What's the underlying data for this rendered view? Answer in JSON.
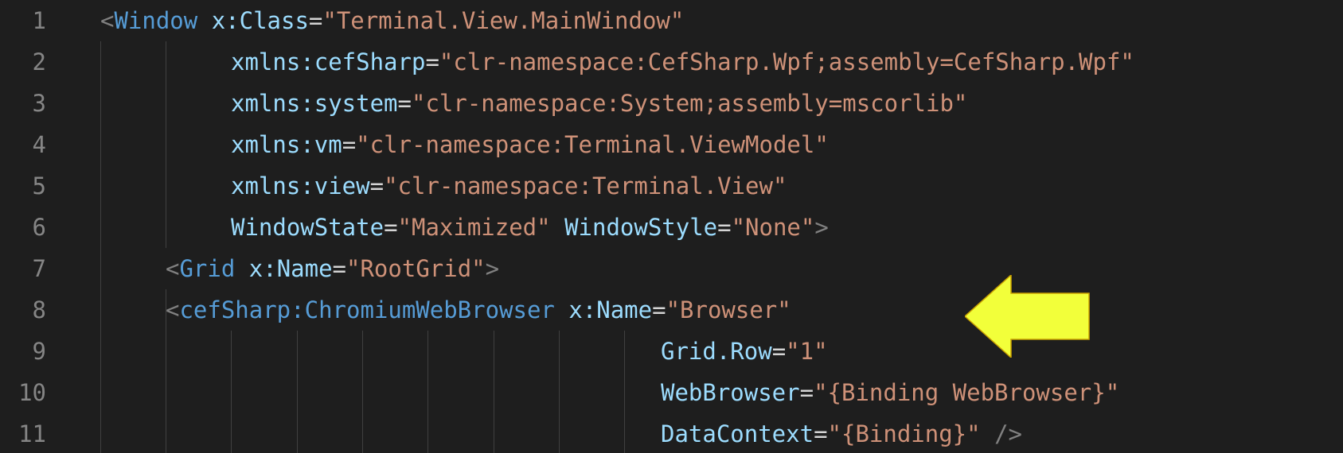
{
  "editor": {
    "accent_arrow_color": "#f2ff3a",
    "lines": [
      {
        "num": "1",
        "tokens": [
          {
            "t": "punct",
            "v": "<"
          },
          {
            "t": "tag",
            "v": "Window"
          },
          {
            "t": "eq",
            "v": " "
          },
          {
            "t": "attr",
            "v": "x:Class"
          },
          {
            "t": "eq",
            "v": "="
          },
          {
            "t": "str",
            "v": "\"Terminal.View.MainWindow\""
          }
        ]
      },
      {
        "num": "2",
        "tokens": [
          {
            "t": "attr",
            "v": "xmlns:cefSharp"
          },
          {
            "t": "eq",
            "v": "="
          },
          {
            "t": "str",
            "v": "\"clr-namespace:CefSharp.Wpf;assembly=CefSharp.Wpf\""
          }
        ]
      },
      {
        "num": "3",
        "tokens": [
          {
            "t": "attr",
            "v": "xmlns:system"
          },
          {
            "t": "eq",
            "v": "="
          },
          {
            "t": "str",
            "v": "\"clr-namespace:System;assembly=mscorlib\""
          }
        ]
      },
      {
        "num": "4",
        "tokens": [
          {
            "t": "attr",
            "v": "xmlns:vm"
          },
          {
            "t": "eq",
            "v": "="
          },
          {
            "t": "str",
            "v": "\"clr-namespace:Terminal.ViewModel\""
          }
        ]
      },
      {
        "num": "5",
        "tokens": [
          {
            "t": "attr",
            "v": "xmlns:view"
          },
          {
            "t": "eq",
            "v": "="
          },
          {
            "t": "str",
            "v": "\"clr-namespace:Terminal.View\""
          }
        ]
      },
      {
        "num": "6",
        "tokens": [
          {
            "t": "attr",
            "v": "WindowState"
          },
          {
            "t": "eq",
            "v": "="
          },
          {
            "t": "str",
            "v": "\"Maximized\""
          },
          {
            "t": "eq",
            "v": " "
          },
          {
            "t": "attr",
            "v": "WindowStyle"
          },
          {
            "t": "eq",
            "v": "="
          },
          {
            "t": "str",
            "v": "\"None\""
          },
          {
            "t": "punct",
            "v": ">"
          }
        ]
      },
      {
        "num": "7",
        "tokens": [
          {
            "t": "punct",
            "v": "<"
          },
          {
            "t": "tag",
            "v": "Grid"
          },
          {
            "t": "eq",
            "v": " "
          },
          {
            "t": "attr",
            "v": "x:Name"
          },
          {
            "t": "eq",
            "v": "="
          },
          {
            "t": "str",
            "v": "\"RootGrid\""
          },
          {
            "t": "punct",
            "v": ">"
          }
        ]
      },
      {
        "num": "8",
        "tokens": [
          {
            "t": "punct",
            "v": "<"
          },
          {
            "t": "tag",
            "v": "cefSharp:ChromiumWebBrowser"
          },
          {
            "t": "eq",
            "v": " "
          },
          {
            "t": "attr",
            "v": "x:Name"
          },
          {
            "t": "eq",
            "v": "="
          },
          {
            "t": "str",
            "v": "\"Browser\""
          }
        ]
      },
      {
        "num": "9",
        "tokens": [
          {
            "t": "attr",
            "v": "Grid.Row"
          },
          {
            "t": "eq",
            "v": "="
          },
          {
            "t": "str",
            "v": "\"1\""
          }
        ]
      },
      {
        "num": "10",
        "tokens": [
          {
            "t": "attr",
            "v": "WebBrowser"
          },
          {
            "t": "eq",
            "v": "="
          },
          {
            "t": "str",
            "v": "\"{Binding WebBrowser}\""
          }
        ]
      },
      {
        "num": "11",
        "tokens": [
          {
            "t": "attr",
            "v": "DataContext"
          },
          {
            "t": "eq",
            "v": "="
          },
          {
            "t": "str",
            "v": "\"{Binding}\""
          },
          {
            "t": "eq",
            "v": " "
          },
          {
            "t": "punct",
            "v": "/>"
          }
        ]
      }
    ]
  }
}
